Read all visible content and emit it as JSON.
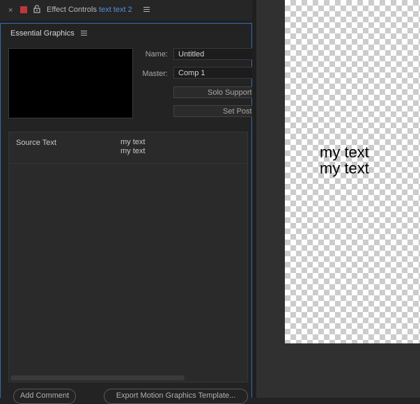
{
  "tab": {
    "close_glyph": "×",
    "swatch_color": "#c0373a",
    "title": "Effect Controls",
    "comp": "text text 2"
  },
  "panel": {
    "title": "Essential Graphics",
    "name_label": "Name:",
    "name_value": "Untitled",
    "master_label": "Master:",
    "master_value": "Comp 1",
    "solo_button": "Solo Supported",
    "poster_button": "Set Poster Time",
    "property": {
      "label": "Source Text",
      "line1": "my text",
      "line2": "my text"
    },
    "add_comment": "Add Comment",
    "export": "Export Motion Graphics Template..."
  },
  "viewer": {
    "line1": "my text",
    "line2": "my text"
  },
  "colors": {
    "accent": "#4f93d8",
    "panel_border": "#2f6eb5"
  }
}
